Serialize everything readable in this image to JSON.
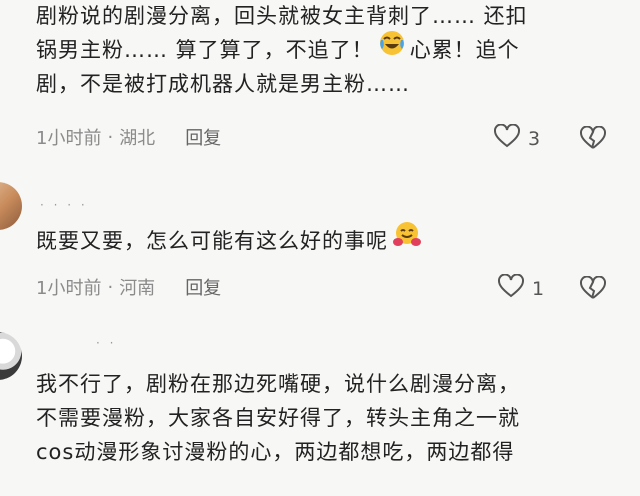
{
  "comments": [
    {
      "lines": [
        "剧粉说的剧漫分离，回头就被女主背刺了…… 还扣",
        "锅男主粉…… 算了算了，不追了！",
        "剧，不是被打成机器人就是男主粉……"
      ],
      "line2_tail": "心累！追个",
      "emoji": "crying-laughing-emoji",
      "time": "1小时前",
      "location": "湖北",
      "reply_label": "回复",
      "likes": "3"
    },
    {
      "lines": [
        "既要又要，怎么可能有这么好的事呢"
      ],
      "emoji": "hugging-face-emoji",
      "time": "1小时前",
      "location": "河南",
      "reply_label": "回复",
      "likes": "1"
    },
    {
      "lines": [
        "我不行了，剧粉在那边死嘴硬，说什么剧漫分离，",
        "不需要漫粉，大家各自安好得了，转头主角之一就",
        "cos动漫形象讨漫粉的心，两边都想吃，两边都得"
      ]
    }
  ],
  "colors": {
    "background": "#f7f7f5",
    "text": "#222222",
    "meta": "#8b8b8b"
  }
}
